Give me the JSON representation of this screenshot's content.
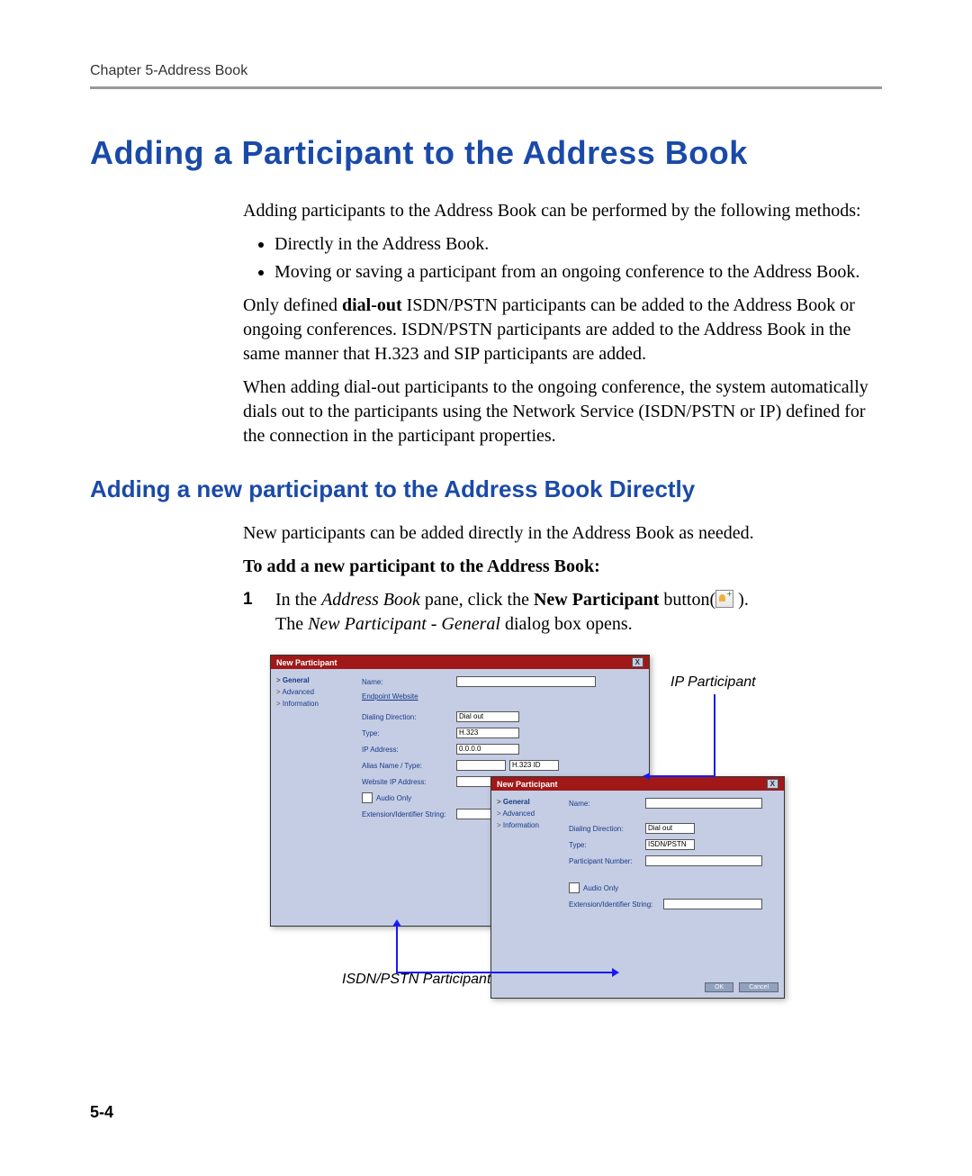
{
  "chapter_header": "Chapter 5-Address Book",
  "h1": "Adding a Participant to the Address Book",
  "intro_para": "Adding participants to the Address Book can be performed by the following methods:",
  "bullets": [
    "Directly in the Address Book.",
    "Moving or saving a participant from an ongoing conference to the Address Book."
  ],
  "para2_prefix": "Only defined ",
  "para2_bold": "dial-out",
  "para2_suffix": " ISDN/PSTN participants can be added to the Address Book or ongoing conferences. ISDN/PSTN participants are added to the Address Book in the same manner that H.323 and SIP participants are added.",
  "para3": "When adding dial-out participants to the ongoing conference, the system automatically dials out to the participants using the Network Service (ISDN/PSTN or IP) defined for the connection in the participant properties.",
  "h2": "Adding a new participant to the Address Book Directly",
  "para4": "New participants can be added directly in the Address Book as needed.",
  "procedure_intro": "To add a new participant to the Address Book:",
  "step1_prefix": "In the ",
  "step1_italic1": "Address Book",
  "step1_mid": " pane, click the ",
  "step1_bold": "New Participant",
  "step1_suffix": " button(",
  "step1_end": " ).",
  "step1b_prefix": "The ",
  "step1b_italic": "New Participant - General",
  "step1b_suffix": " dialog box opens.",
  "callout_right": "IP Participant",
  "callout_bottom": "ISDN/PSTN Participant",
  "page_number": "5-4",
  "dialog1": {
    "title": "New Participant",
    "nav": [
      "General",
      "Advanced",
      "Information"
    ],
    "fields": {
      "name": "Name:",
      "endpoint_link": "Endpoint Website",
      "dialdir": "Dialing Direction:",
      "dialdir_val": "Dial out",
      "type": "Type:",
      "type_val": "H.323",
      "ipaddr": "IP Address:",
      "ipaddr_val": "0.0.0.0",
      "alias": "Alias Name / Type:",
      "alias_type": "H.323 ID",
      "website_ip": "Website IP Address:",
      "audio_only": "Audio Only",
      "ext": "Extension/Identifier String:"
    }
  },
  "dialog2": {
    "title": "New Participant",
    "nav": [
      "General",
      "Advanced",
      "Information"
    ],
    "fields": {
      "name": "Name:",
      "dialdir": "Dialing Direction:",
      "dialdir_val": "Dial out",
      "type": "Type:",
      "type_val": "ISDN/PSTN",
      "partnum": "Participant Number:",
      "audio_only": "Audio Only",
      "ext": "Extension/Identifier String:"
    },
    "buttons": {
      "ok": "OK",
      "cancel": "Cancel"
    }
  }
}
